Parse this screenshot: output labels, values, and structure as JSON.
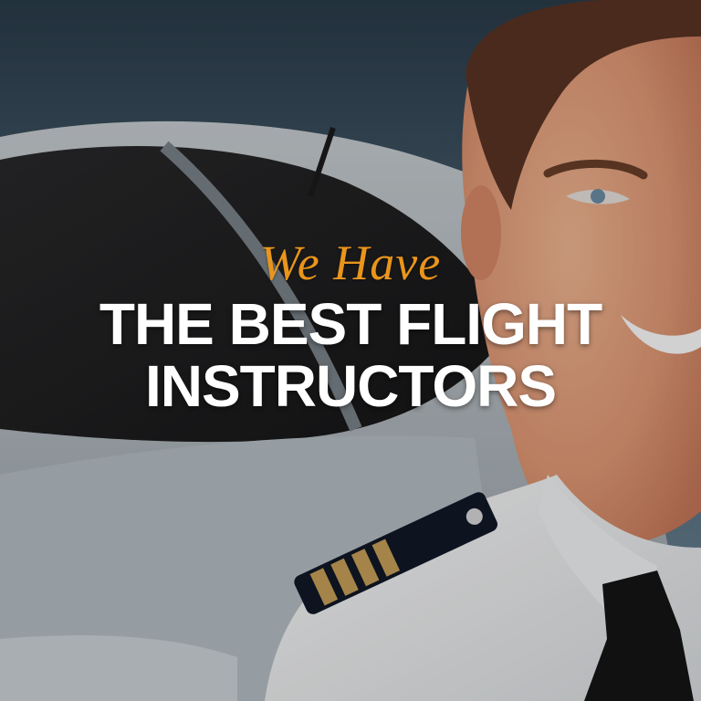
{
  "headline": {
    "script_line": "We Have",
    "bold_line_1": "THE BEST FLIGHT",
    "bold_line_2": "INSTRUCTORS"
  },
  "colors": {
    "script_accent": "#e9951c",
    "bold_text": "#ffffff"
  }
}
